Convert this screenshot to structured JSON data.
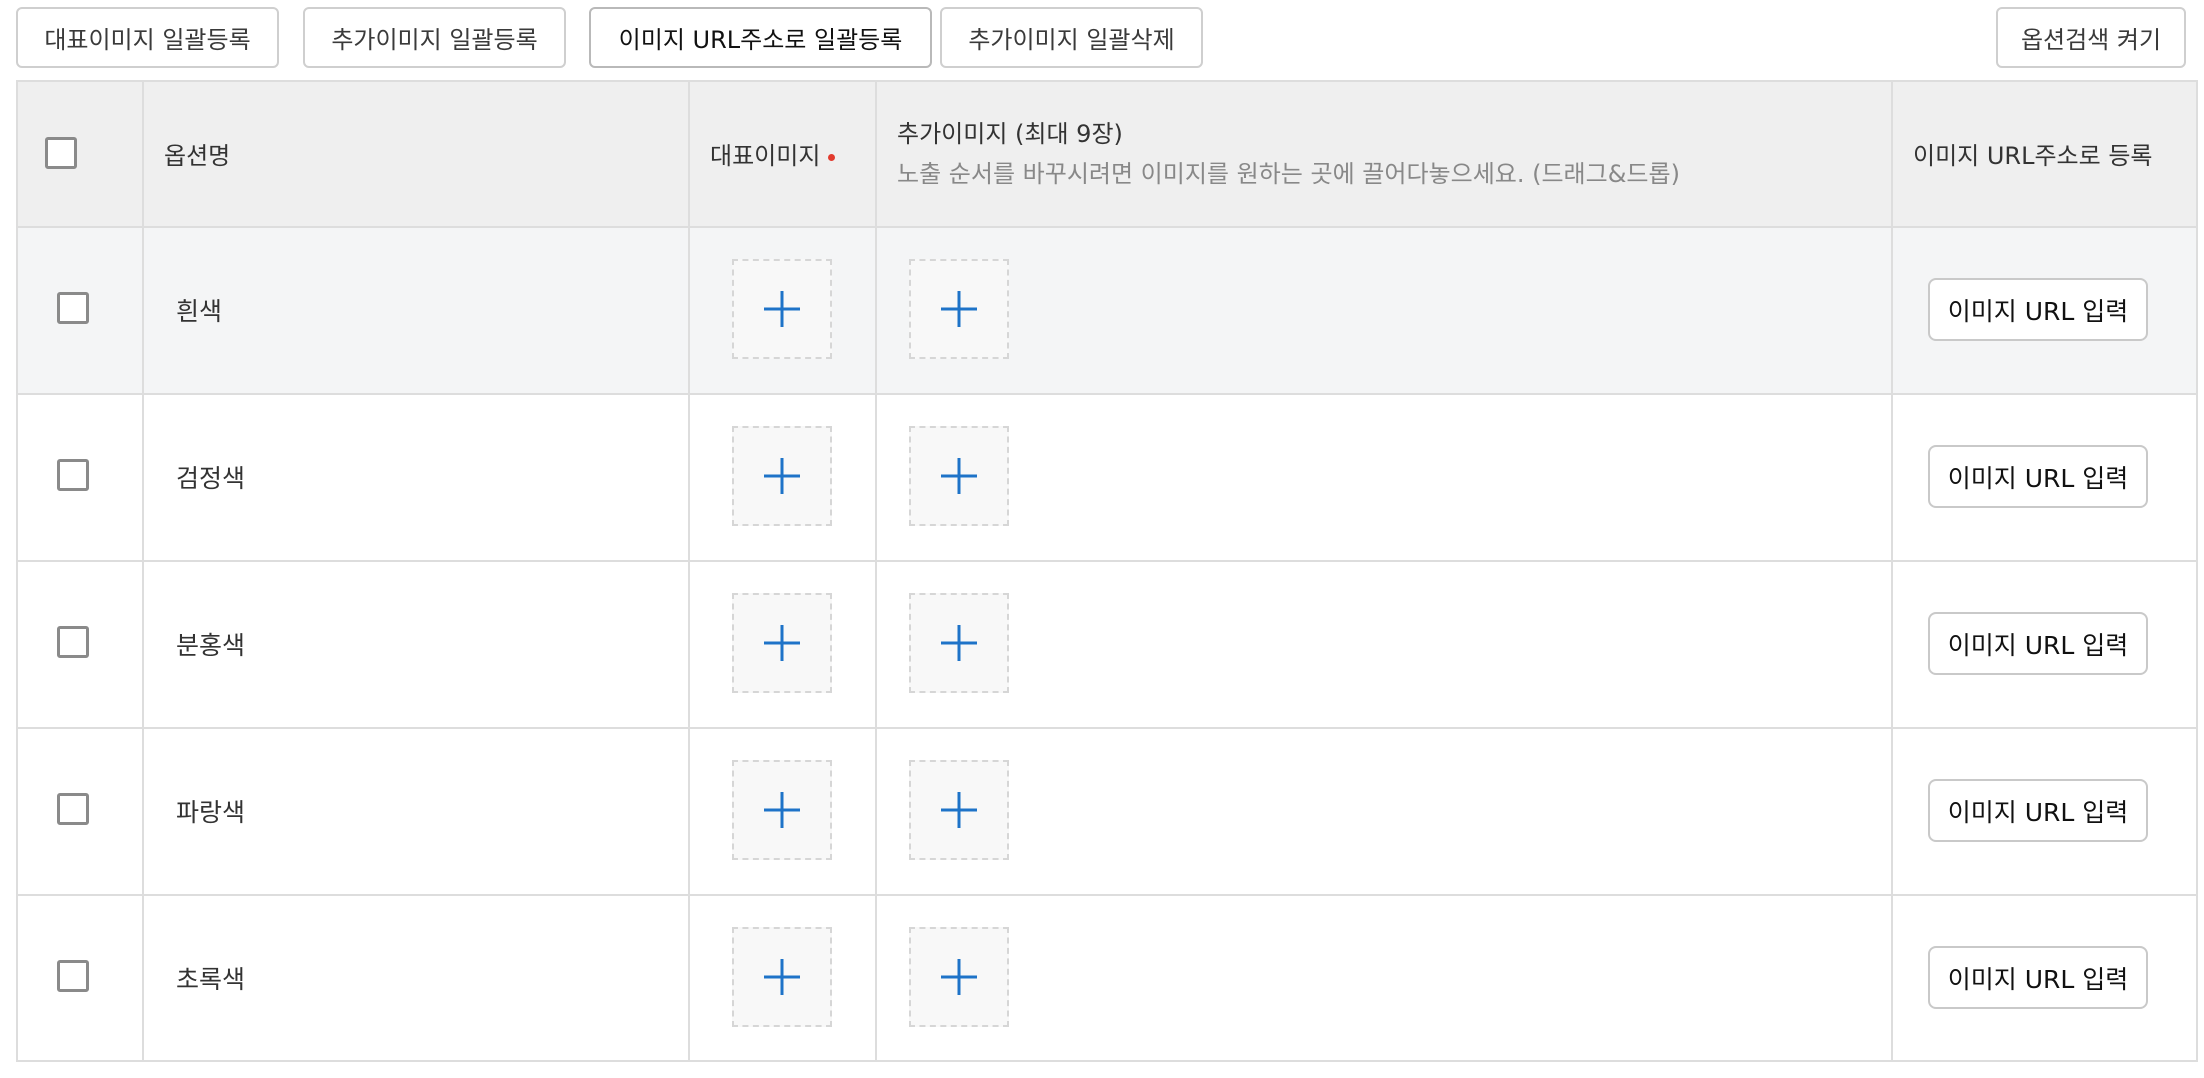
{
  "toolbar": {
    "bulk_main_image": "대표이미지 일괄등록",
    "bulk_extra_image": "추가이미지 일괄등록",
    "bulk_url": "이미지 URL주소로 일괄등록",
    "bulk_delete_extra": "추가이미지 일괄삭제",
    "option_search_toggle": "옵션검색 켜기"
  },
  "table": {
    "headers": {
      "option_name": "옵션명",
      "main_image": "대표이미지",
      "extra_image": "추가이미지 (최대 9장)",
      "extra_image_hint": "노출 순서를 바꾸시려면 이미지를 원하는 곳에 끌어다놓으세요. (드래그&드롭)",
      "url_register": "이미지 URL주소로 등록"
    },
    "rows": [
      {
        "name": "흰색",
        "url_button": "이미지 URL 입력"
      },
      {
        "name": "검정색",
        "url_button": "이미지 URL 입력"
      },
      {
        "name": "분홍색",
        "url_button": "이미지 URL 입력"
      },
      {
        "name": "파랑색",
        "url_button": "이미지 URL 입력"
      },
      {
        "name": "초록색",
        "url_button": "이미지 URL 입력"
      }
    ]
  },
  "colors": {
    "plus_icon": "#1e73c8",
    "required_dot": "#e23b2e",
    "header_bg": "#efefef",
    "first_row_bg": "#f4f5f6"
  }
}
